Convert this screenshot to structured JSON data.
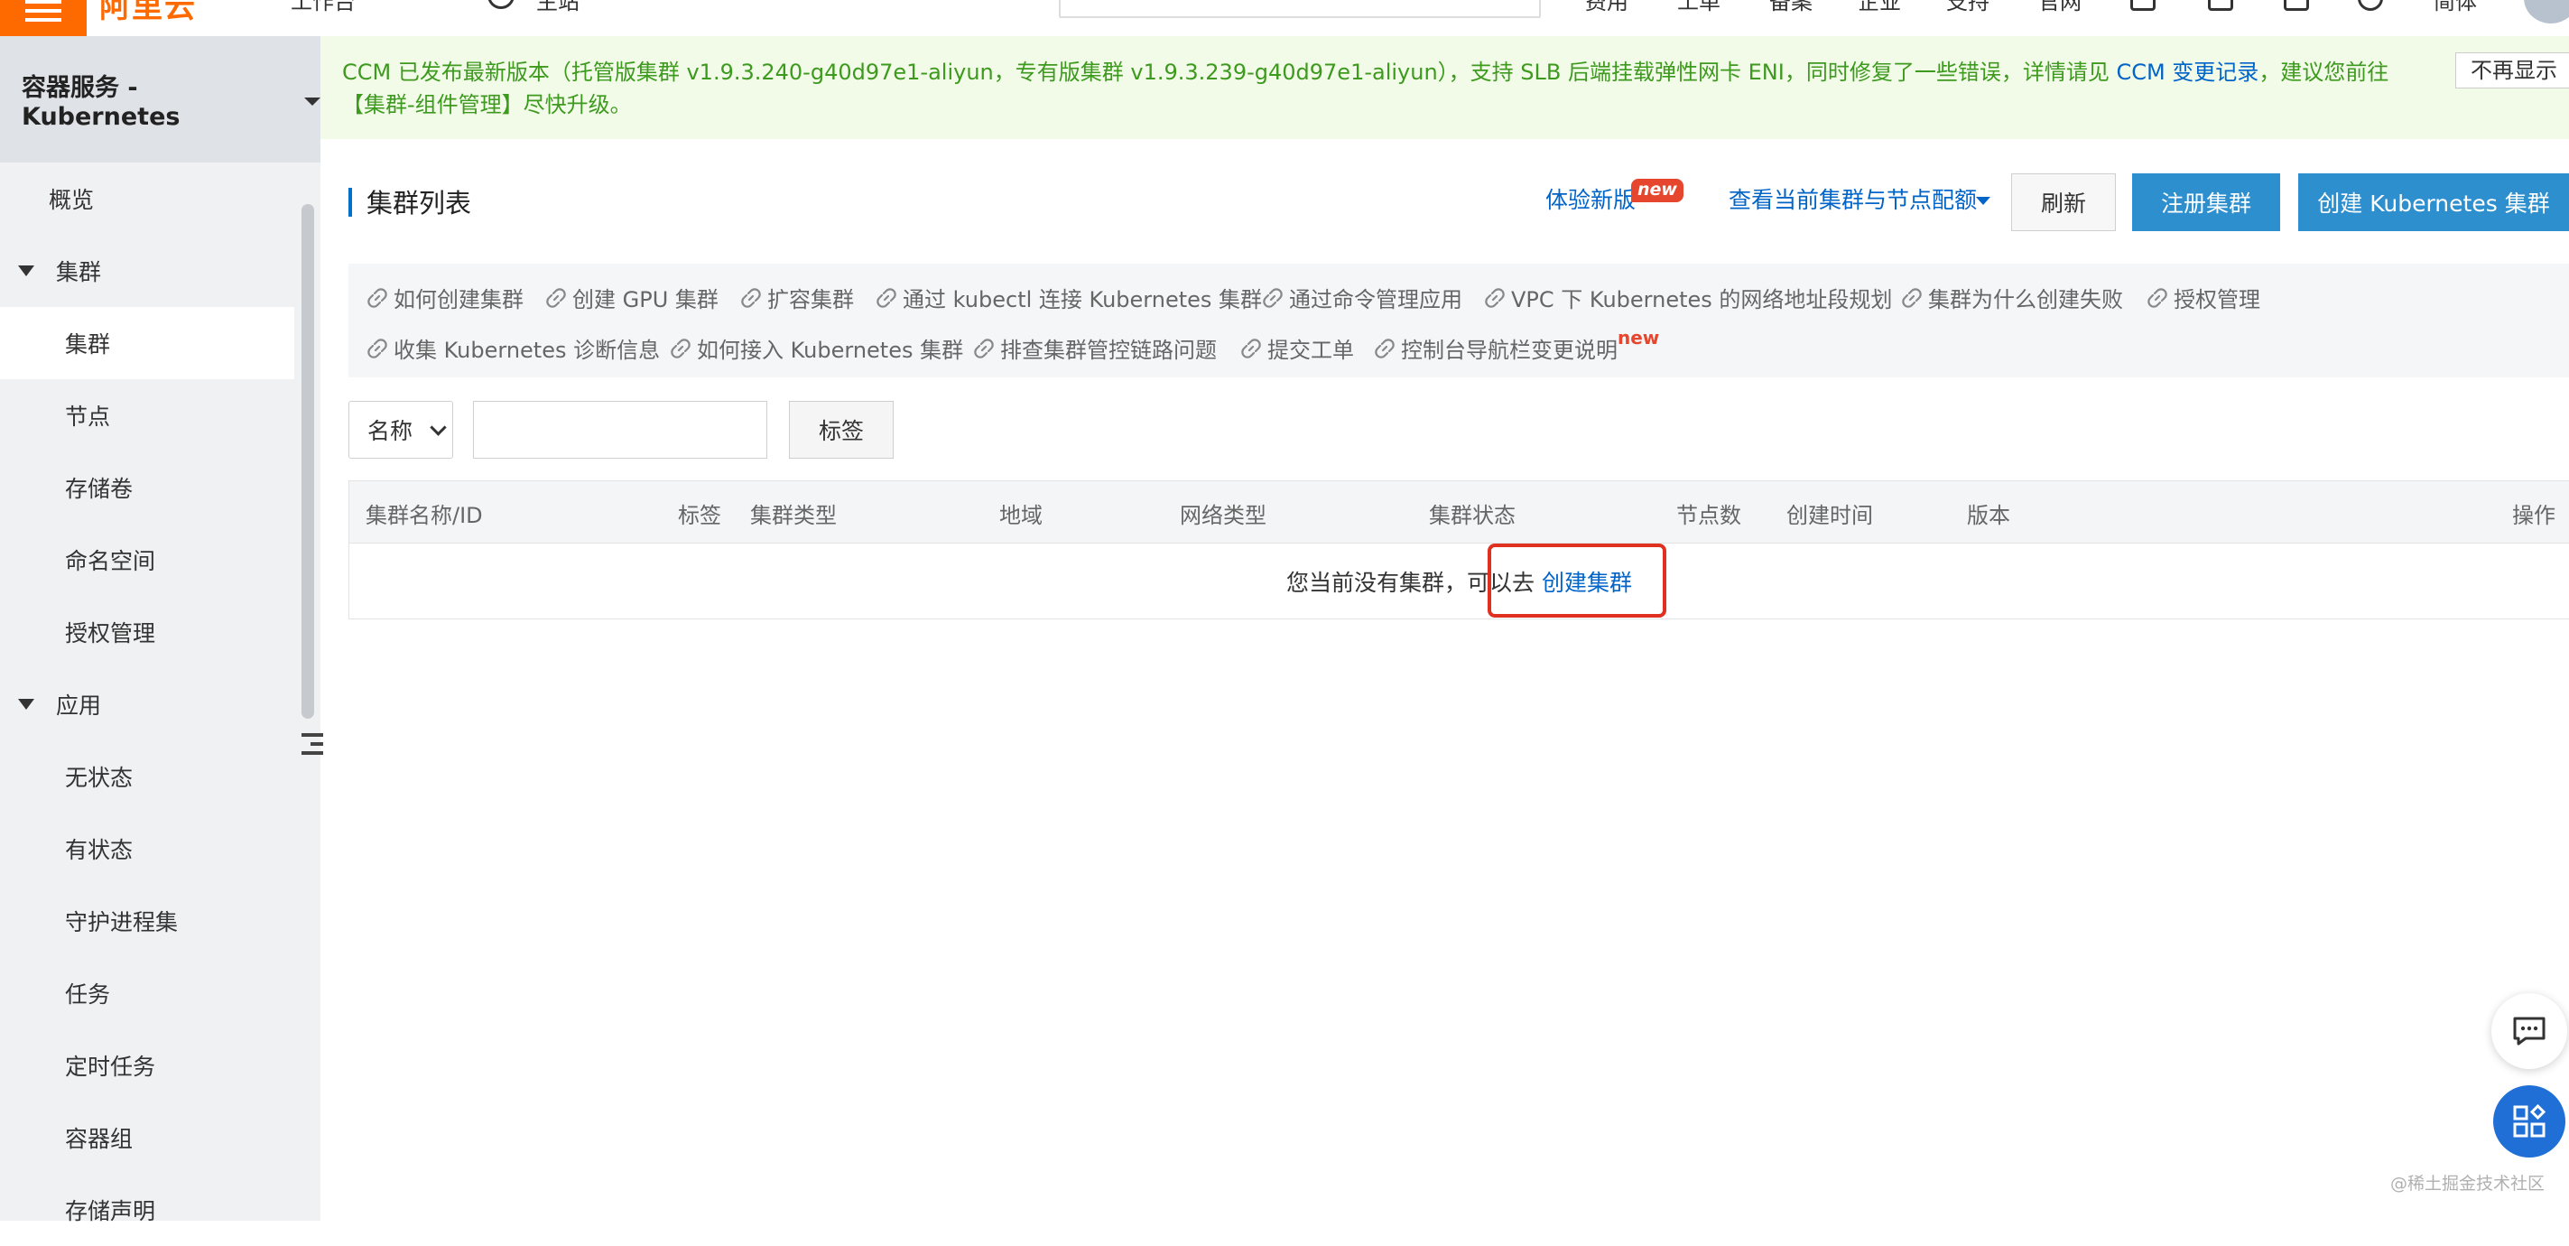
{
  "topbar": {
    "logo": "阿里云",
    "breadcrumb": "工作台",
    "home": "主站",
    "nav": [
      "费用",
      "工单",
      "备案",
      "企业",
      "支持",
      "官网",
      "简体"
    ]
  },
  "sidebar": {
    "title": "容器服务 - Kubernetes",
    "items": [
      {
        "label": "概览",
        "kind": "top"
      },
      {
        "label": "集群",
        "kind": "group"
      },
      {
        "label": "集群",
        "kind": "child",
        "active": true
      },
      {
        "label": "节点",
        "kind": "child"
      },
      {
        "label": "存储卷",
        "kind": "child"
      },
      {
        "label": "命名空间",
        "kind": "child"
      },
      {
        "label": "授权管理",
        "kind": "child"
      },
      {
        "label": "应用",
        "kind": "group"
      },
      {
        "label": "无状态",
        "kind": "child"
      },
      {
        "label": "有状态",
        "kind": "child"
      },
      {
        "label": "守护进程集",
        "kind": "child"
      },
      {
        "label": "任务",
        "kind": "child"
      },
      {
        "label": "定时任务",
        "kind": "child"
      },
      {
        "label": "容器组",
        "kind": "child"
      },
      {
        "label": "存储声明",
        "kind": "child"
      }
    ]
  },
  "notice": {
    "text_before": "CCM 已发布最新版本（托管版集群 v1.9.3.240-g40d97e1-aliyun，专有版集群 v1.9.3.239-g40d97e1-aliyun），支持 SLB 后端挂载弹性网卡 ENI，同时修复了一些错误，详情请见 ",
    "link": "CCM 变更记录",
    "text_after": "，建议您前往【集群-组件管理】尽快升级。",
    "close_label": "不再显示"
  },
  "header": {
    "title": "集群列表",
    "try_new": "体验新版",
    "try_new_badge": "new",
    "quota_link": "查看当前集群与节点配额",
    "refresh": "刷新",
    "register": "注册集群",
    "create": "创建 Kubernetes 集群"
  },
  "help_links": [
    "如何创建集群",
    "创建 GPU 集群",
    "扩容集群",
    "通过 kubectl 连接 Kubernetes 集群",
    "通过命令管理应用",
    "VPC 下 Kubernetes 的网络地址段规划",
    "集群为什么创建失败",
    "授权管理",
    "收集 Kubernetes 诊断信息",
    "如何接入 Kubernetes 集群",
    "排查集群管控链路问题",
    "提交工单",
    "控制台导航栏变更说明"
  ],
  "help_new_badge": "new",
  "filter": {
    "select_value": "名称",
    "search_value": "",
    "tag_button": "标签"
  },
  "table": {
    "columns": [
      "集群名称/ID",
      "标签",
      "集群类型",
      "地域",
      "网络类型",
      "集群状态",
      "节点数",
      "创建时间",
      "版本",
      "操作"
    ],
    "empty_text": "您当前没有集群，可以去",
    "empty_link": "创建集群"
  },
  "watermark": "@稀土掘金技术社区",
  "colors": {
    "brand": "#ff6a00",
    "link": "#0064c8",
    "primary_button": "#2e8fcf",
    "notice_text": "#3d9a1e",
    "highlight": "#e03020"
  }
}
